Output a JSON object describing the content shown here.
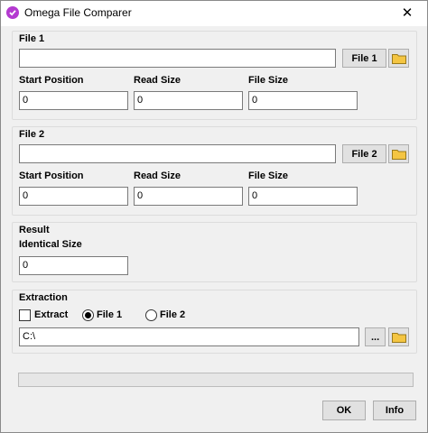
{
  "window": {
    "title": "Omega File Comparer",
    "close_glyph": "✕"
  },
  "file1": {
    "group_title": "File 1",
    "path": "",
    "browse_label": "File 1",
    "start_position_label": "Start Position",
    "start_position": "0",
    "read_size_label": "Read Size",
    "read_size": "0",
    "file_size_label": "File Size",
    "file_size": "0"
  },
  "file2": {
    "group_title": "File 2",
    "path": "",
    "browse_label": "File 2",
    "start_position_label": "Start Position",
    "start_position": "0",
    "read_size_label": "Read Size",
    "read_size": "0",
    "file_size_label": "File Size",
    "file_size": "0"
  },
  "result": {
    "group_title": "Result",
    "identical_size_label": "Identical Size",
    "identical_size": "0"
  },
  "extraction": {
    "group_title": "Extraction",
    "extract_label": "Extract",
    "extract_checked": false,
    "radio_file1_label": "File 1",
    "radio_file2_label": "File 2",
    "selected": "File 1",
    "path": "C:\\",
    "browse_label": "..."
  },
  "progress": {
    "value": 0
  },
  "buttons": {
    "ok_label": "OK",
    "info_label": "Info"
  },
  "icons": {
    "app": "check-circle-icon",
    "folder": "folder-icon"
  },
  "colors": {
    "accent": "#b43ad0",
    "folder": "#f4c542"
  }
}
